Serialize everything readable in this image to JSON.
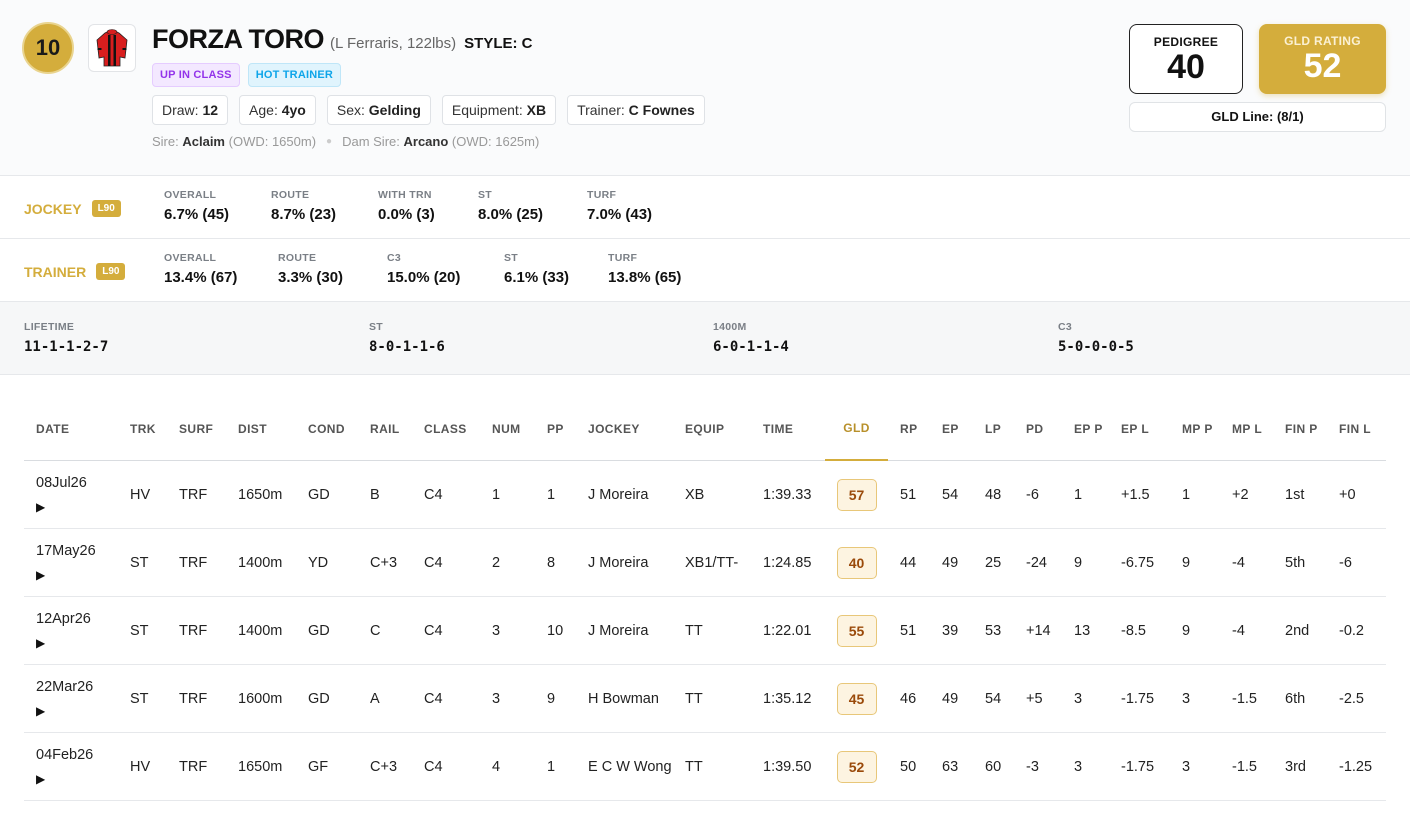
{
  "horse": {
    "number": "10",
    "name": "FORZA TORO",
    "sub": "(L Ferraris, 122lbs)",
    "style": "STYLE: C",
    "tags": [
      "UP IN CLASS",
      "HOT TRAINER"
    ],
    "draw_label": "Draw:",
    "draw": "12",
    "age_label": "Age:",
    "age": "4yo",
    "sex_label": "Sex:",
    "sex": "Gelding",
    "equip_label": "Equipment:",
    "equip": "XB",
    "trainer_label": "Trainer:",
    "trainer": "C Fownes",
    "sire_label": "Sire:",
    "sire": "Aclaim",
    "sire_owd": "(OWD: 1650m)",
    "damsire_label": "Dam Sire:",
    "damsire": "Arcano",
    "damsire_owd": "(OWD: 1625m)"
  },
  "ratings": {
    "pedigree_label": "PEDIGREE",
    "pedigree": "40",
    "gld_label": "GLD RATING",
    "gld": "52",
    "gld_line": "GLD Line: (8/1)"
  },
  "jockey": {
    "label": "JOCKEY",
    "badge": "L90",
    "stats": [
      {
        "k": "OVERALL",
        "v": "6.7% (45)"
      },
      {
        "k": "ROUTE",
        "v": "8.7% (23)"
      },
      {
        "k": "WITH TRN",
        "v": "0.0% (3)"
      },
      {
        "k": "ST",
        "v": "8.0% (25)"
      },
      {
        "k": "TURF",
        "v": "7.0% (43)"
      }
    ]
  },
  "trainer": {
    "label": "TRAINER",
    "badge": "L90",
    "stats": [
      {
        "k": "OVERALL",
        "v": "13.4% (67)"
      },
      {
        "k": "ROUTE",
        "v": "3.3% (30)"
      },
      {
        "k": "C3",
        "v": "15.0% (20)"
      },
      {
        "k": "ST",
        "v": "6.1% (33)"
      },
      {
        "k": "TURF",
        "v": "13.8% (65)"
      }
    ]
  },
  "records": [
    {
      "k": "LIFETIME",
      "v": "11-1-1-2-7"
    },
    {
      "k": "ST",
      "v": "8-0-1-1-6"
    },
    {
      "k": "1400M",
      "v": "6-0-1-1-4"
    },
    {
      "k": "C3",
      "v": "5-0-0-0-5"
    }
  ],
  "table": {
    "headers": [
      "DATE",
      "TRK",
      "SURF",
      "DIST",
      "COND",
      "RAIL",
      "CLASS",
      "NUM",
      "PP",
      "JOCKEY",
      "EQUIP",
      "TIME",
      "GLD",
      "RP",
      "EP",
      "LP",
      "PD",
      "EP P",
      "EP L",
      "MP P",
      "MP L",
      "FIN P",
      "FIN L"
    ],
    "play_glyph": "▶",
    "rows": [
      [
        "08Jul26",
        "HV",
        "TRF",
        "1650m",
        "GD",
        "B",
        "C4",
        "1",
        "1",
        "J Moreira",
        "XB",
        "1:39.33",
        "57",
        "51",
        "54",
        "48",
        "-6",
        "1",
        "+1.5",
        "1",
        "+2",
        "1st",
        "+0"
      ],
      [
        "17May26",
        "ST",
        "TRF",
        "1400m",
        "YD",
        "C+3",
        "C4",
        "2",
        "8",
        "J Moreira",
        "XB1/TT-",
        "1:24.85",
        "40",
        "44",
        "49",
        "25",
        "-24",
        "9",
        "-6.75",
        "9",
        "-4",
        "5th",
        "-6"
      ],
      [
        "12Apr26",
        "ST",
        "TRF",
        "1400m",
        "GD",
        "C",
        "C4",
        "3",
        "10",
        "J Moreira",
        "TT",
        "1:22.01",
        "55",
        "51",
        "39",
        "53",
        "+14",
        "13",
        "-8.5",
        "9",
        "-4",
        "2nd",
        "-0.2"
      ],
      [
        "22Mar26",
        "ST",
        "TRF",
        "1600m",
        "GD",
        "A",
        "C4",
        "3",
        "9",
        "H Bowman",
        "TT",
        "1:35.12",
        "45",
        "46",
        "49",
        "54",
        "+5",
        "3",
        "-1.75",
        "3",
        "-1.5",
        "6th",
        "-2.5"
      ],
      [
        "04Feb26",
        "HV",
        "TRF",
        "1650m",
        "GF",
        "C+3",
        "C4",
        "4",
        "1",
        "E C W Wong",
        "TT",
        "1:39.50",
        "52",
        "50",
        "63",
        "60",
        "-3",
        "3",
        "-1.75",
        "3",
        "-1.5",
        "3rd",
        "-1.25"
      ]
    ]
  }
}
